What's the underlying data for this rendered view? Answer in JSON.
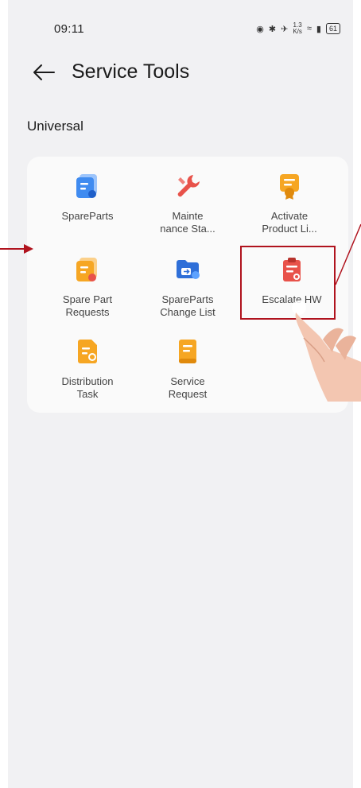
{
  "status_bar": {
    "time": "09:11",
    "speed_top": "1.3",
    "speed_bottom": "K/s",
    "battery": "61"
  },
  "header": {
    "title": "Service Tools"
  },
  "section": {
    "label": "Universal"
  },
  "tools": [
    {
      "label_line1": "SpareParts",
      "label_line2": "",
      "icon": "spare-parts-icon"
    },
    {
      "label_line1": "Mainte",
      "label_line2": "nance Sta...",
      "icon": "maintenance-wrench-icon"
    },
    {
      "label_line1": "Activate",
      "label_line2": "Product Li...",
      "icon": "activate-license-icon"
    },
    {
      "label_line1": "Spare Part",
      "label_line2": "Requests",
      "icon": "spare-part-requests-icon"
    },
    {
      "label_line1": "SpareParts",
      "label_line2": "Change List",
      "icon": "change-list-folder-icon"
    },
    {
      "label_line1": "Escalate HW",
      "label_line2": "",
      "icon": "escalate-hw-clipboard-icon"
    },
    {
      "label_line1": "Distribution",
      "label_line2": "Task",
      "icon": "distribution-task-icon"
    },
    {
      "label_line1": "Service",
      "label_line2": "Request",
      "icon": "service-request-icon"
    }
  ],
  "colors": {
    "accent_red": "#b0131e",
    "blue": "#3f8bf0",
    "orange": "#f6a623",
    "red": "#e8524a"
  }
}
